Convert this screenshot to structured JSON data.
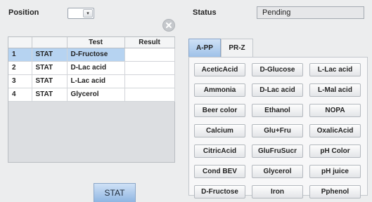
{
  "position": {
    "label": "Position",
    "value": ""
  },
  "status": {
    "label": "Status",
    "value": "Pending"
  },
  "table": {
    "columns": [
      "",
      "",
      "Test",
      "Result"
    ],
    "rows": [
      {
        "num": "1",
        "type": "STAT",
        "test": "D-Fructose",
        "result": "",
        "selected": true
      },
      {
        "num": "2",
        "type": "STAT",
        "test": "D-Lac acid",
        "result": ""
      },
      {
        "num": "3",
        "type": "STAT",
        "test": "L-Lac acid",
        "result": ""
      },
      {
        "num": "4",
        "type": "STAT",
        "test": "Glycerol",
        "result": ""
      }
    ]
  },
  "stat_button": "STAT",
  "tabs": [
    "A-PP",
    "PR-Z"
  ],
  "active_tab": "A-PP",
  "tests": [
    "AceticAcid",
    "D-Glucose",
    "L-Lac acid",
    "Ammonia",
    "D-Lac acid",
    "L-Mal acid",
    "Beer color",
    "Ethanol",
    "NOPA",
    "Calcium",
    "Glu+Fru",
    "OxalicAcid",
    "CitricAcid",
    "GluFruSucr",
    "pH Color",
    "Cond BEV",
    "Glycerol",
    "pH juice",
    "D-Fructose",
    "Iron",
    "Pphenol"
  ],
  "icons": {
    "dropdown": "chevron-down-icon",
    "clear": "close-icon"
  },
  "colors": {
    "selected_row": "#b6d3f1",
    "accent": "#9ec1e8"
  }
}
